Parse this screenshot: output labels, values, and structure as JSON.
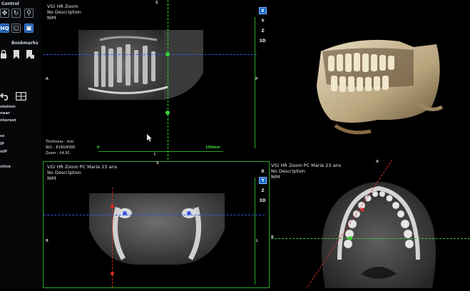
{
  "sidebar": {
    "control_label": "Control",
    "bookmarks_label": "Bookmarks",
    "tools": [
      {
        "name": "move-tool",
        "glyph": "✥"
      },
      {
        "name": "rotate-tool",
        "glyph": "↻"
      },
      {
        "name": "zoom-tool",
        "glyph": "⚲"
      },
      {
        "name": "hq-tool",
        "glyph": "HQ"
      },
      {
        "name": "crop-tool",
        "glyph": "◱"
      },
      {
        "name": "layout-tool",
        "glyph": "▣"
      }
    ],
    "bookmark_icons": [
      "lock-icon",
      "bookmark-icon",
      "bookmark-add-icon"
    ],
    "options": [
      "olution",
      "near",
      "nterest",
      "ss",
      "IP",
      "nIP",
      "ctive"
    ]
  },
  "top_left_view": {
    "title": "VGi HR Zoom",
    "subtitle": "No Description",
    "third": "NIM",
    "marker_s": "S",
    "marker_a": "A",
    "marker_p": "P",
    "marker_i": "I",
    "thickness": "Thickness : mm",
    "wl": "W/L : 8190/4095",
    "zoom": "Zoom : X4.91",
    "scale_start": "0",
    "scale_end": "100mm",
    "axis_buttons": [
      "X",
      "Y",
      "Z",
      "3D"
    ],
    "active_axis": "X"
  },
  "bottom_left_view": {
    "title": "VGi HR Zoom PC Marie 23 ans",
    "subtitle": "No Description",
    "third": "NIM",
    "marker_s": "S",
    "marker_r": "R",
    "marker_l": "L",
    "axis_buttons": [
      "X",
      "Y",
      "Z",
      "3D"
    ],
    "active_axis": "Y"
  },
  "bottom_right_view": {
    "title": "VGi HR Zoom PC Marie 23 ans",
    "subtitle": "No Description",
    "third": "NIM",
    "marker_a": "A",
    "marker_r": "R"
  },
  "colors": {
    "frame_green": "#2ba62b",
    "crosshair_blue": "#3b55e6",
    "crosshair_red": "#e02828",
    "active_axis_blue": "#1565c8"
  }
}
